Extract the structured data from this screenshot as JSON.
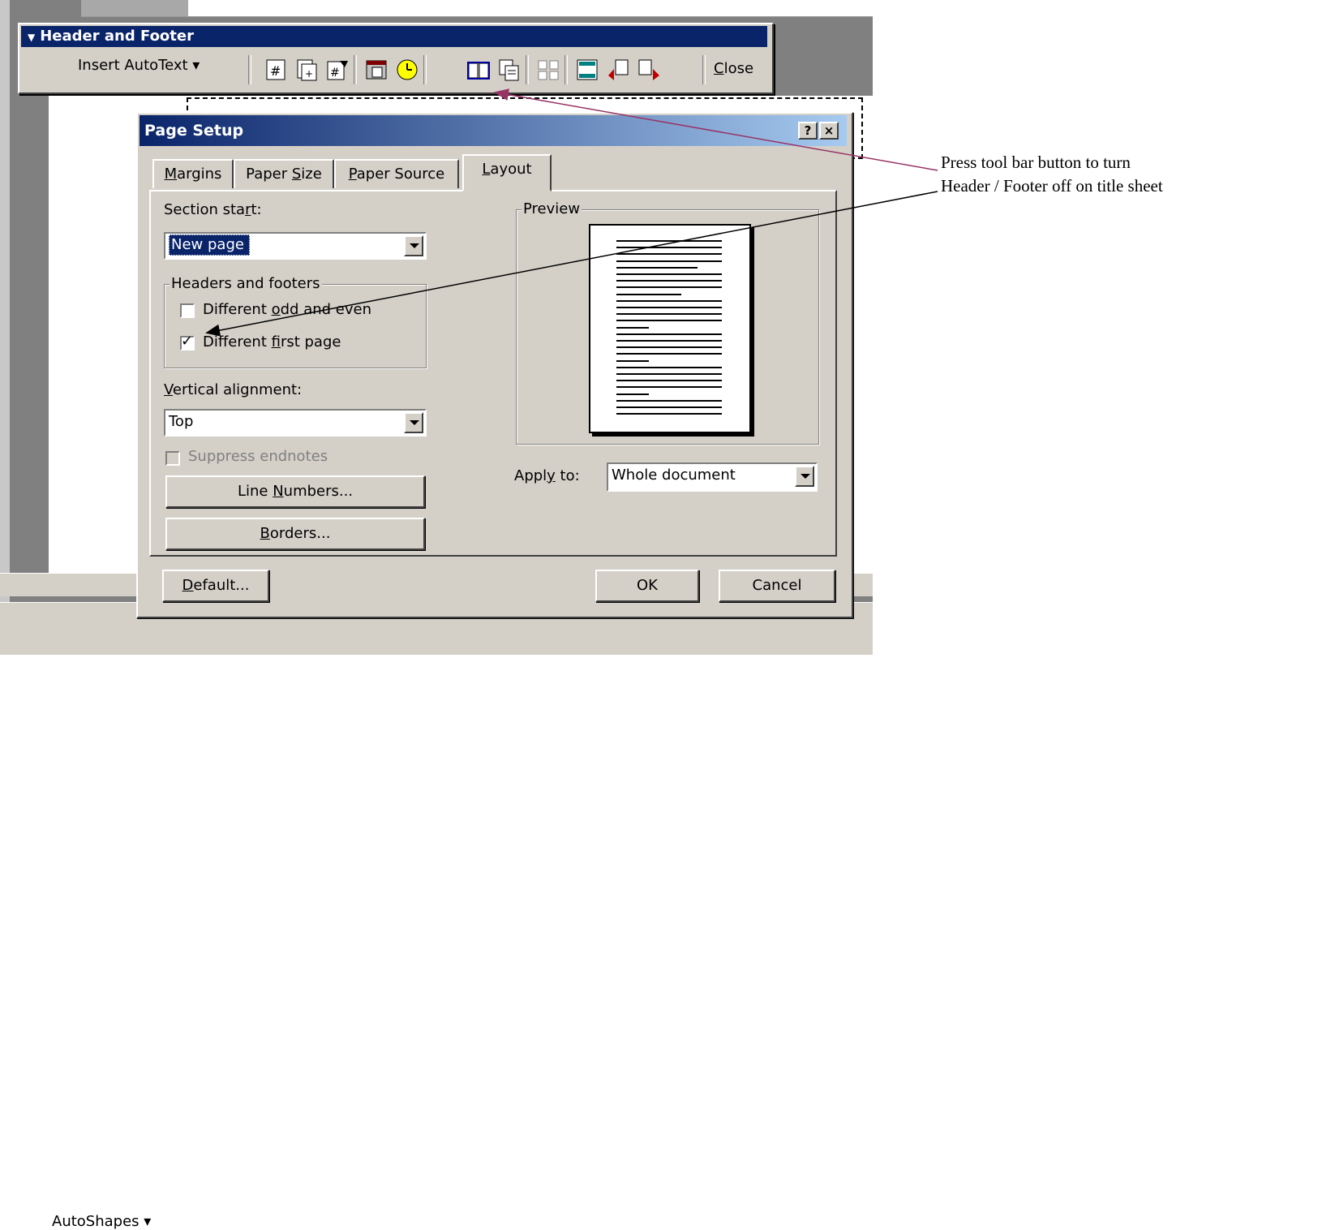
{
  "toolbar": {
    "title": "Header and Footer",
    "insert_autotext": "Insert AutoText ▾",
    "close": "Close",
    "buttons": [
      "insert-page-number",
      "insert-number-of-pages",
      "format-page-number",
      "insert-date",
      "insert-time",
      "page-setup",
      "show-hide-document-text",
      "same-as-previous",
      "switch-header-footer",
      "show-previous",
      "show-next"
    ]
  },
  "dialog": {
    "title": "Page Setup",
    "help": "?",
    "close": "×",
    "tabs": [
      "Margins",
      "Paper Size",
      "Paper Source",
      "Layout"
    ],
    "active_tab": "Layout",
    "section_start_label": "Section start:",
    "section_start_value": "New page",
    "headers_footers_legend": "Headers and footers",
    "diff_odd_even": "Different odd and even",
    "diff_odd_even_checked": false,
    "diff_first_page": "Different first page",
    "diff_first_page_checked": true,
    "vertical_alignment_label": "Vertical alignment:",
    "vertical_alignment_value": "Top",
    "suppress_endnotes": "Suppress endnotes",
    "line_numbers": "Line Numbers...",
    "borders": "Borders...",
    "preview_legend": "Preview",
    "apply_to_label": "Apply to:",
    "apply_to_value": "Whole document",
    "default_btn": "Default...",
    "ok_btn": "OK",
    "cancel_btn": "Cancel"
  },
  "word": {
    "autoshapes": "AutoShapes ▾"
  },
  "annotation": {
    "line1": "Press tool bar button to turn",
    "line2": "Header / Footer off on title sheet"
  },
  "colors": {
    "titlebar": "#0a246a",
    "face": "#d4d0c8",
    "arrow_maroon": "#993366",
    "arrow_black": "#000000"
  }
}
